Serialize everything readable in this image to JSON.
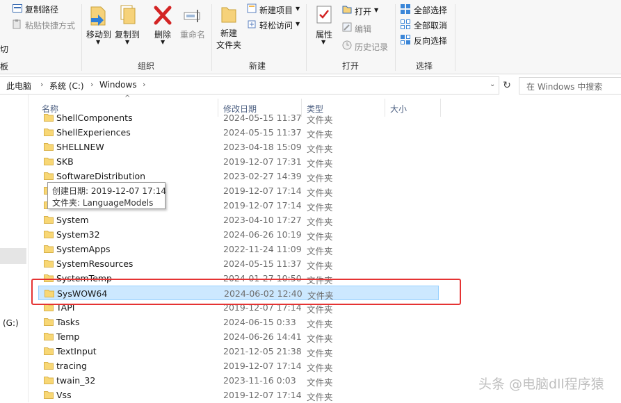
{
  "ribbon": {
    "clipboard": {
      "copy_path": "复制路径",
      "paste_shortcut": "粘贴快捷方式",
      "cut_partial": "切",
      "group_partial": "板"
    },
    "organize": {
      "move_to": "移动到",
      "copy_to": "复制到",
      "delete": "删除",
      "rename": "重命名",
      "group_label": "组织"
    },
    "new": {
      "new_folder_line1": "新建",
      "new_folder_line2": "文件夹",
      "new_item": "新建项目",
      "easy_access": "轻松访问",
      "group_label": "新建"
    },
    "open": {
      "properties": "属性",
      "open": "打开",
      "edit": "编辑",
      "history": "历史记录",
      "group_label": "打开"
    },
    "select": {
      "select_all": "全部选择",
      "select_none": "全部取消",
      "invert": "反向选择",
      "group_label": "选择"
    }
  },
  "address": {
    "crumbs": [
      "此电脑",
      "系统 (C:)",
      "Windows"
    ],
    "search_placeholder": "在 Windows 中搜索"
  },
  "nav": {
    "drive_partial": "(G:)"
  },
  "columns": {
    "name": "名称",
    "date": "修改日期",
    "type": "类型",
    "size": "大小"
  },
  "rows": [
    {
      "name": "ShellComponents",
      "date": "2024-05-15 11:37",
      "type": "文件夹"
    },
    {
      "name": "ShellExperiences",
      "date": "2024-05-15 11:37",
      "type": "文件夹"
    },
    {
      "name": "SHELLNEW",
      "date": "2023-04-18 15:09",
      "type": "文件夹"
    },
    {
      "name": "SKB",
      "date": "2019-12-07 17:31",
      "type": "文件夹"
    },
    {
      "name": "SoftwareDistribution",
      "date": "2023-02-27 14:39",
      "type": "文件夹"
    },
    {
      "name": "",
      "date": "2019-12-07 17:14",
      "type": "文件夹"
    },
    {
      "name": "",
      "date": "2019-12-07 17:14",
      "type": "文件夹"
    },
    {
      "name": "System",
      "date": "2023-04-10 17:27",
      "type": "文件夹"
    },
    {
      "name": "System32",
      "date": "2024-06-26 10:19",
      "type": "文件夹"
    },
    {
      "name": "SystemApps",
      "date": "2022-11-24 11:09",
      "type": "文件夹"
    },
    {
      "name": "SystemResources",
      "date": "2024-05-15 11:37",
      "type": "文件夹"
    },
    {
      "name": "SystemTemp",
      "date": "2024-01-27 10:50",
      "type": "文件夹"
    },
    {
      "name": "SysWOW64",
      "date": "2024-06-02 12:40",
      "type": "文件夹"
    },
    {
      "name": "TAPI",
      "date": "2019-12-07 17:14",
      "type": "文件夹"
    },
    {
      "name": "Tasks",
      "date": "2024-06-15 0:33",
      "type": "文件夹"
    },
    {
      "name": "Temp",
      "date": "2024-06-26 14:41",
      "type": "文件夹"
    },
    {
      "name": "TextInput",
      "date": "2021-12-05 21:38",
      "type": "文件夹"
    },
    {
      "name": "tracing",
      "date": "2019-12-07 17:14",
      "type": "文件夹"
    },
    {
      "name": "twain_32",
      "date": "2023-11-16 0:03",
      "type": "文件夹"
    },
    {
      "name": "Vss",
      "date": "2019-12-07 17:14",
      "type": "文件夹"
    }
  ],
  "tooltip": {
    "line1": "创建日期: 2019-12-07 17:14",
    "line2": "文件夹: LanguageModels"
  },
  "watermark": "头条 @电脑dll程序猿",
  "colors": {
    "selection_fill": "#cce8ff",
    "selection_border": "#99d1ff",
    "highlight_box": "#e53333",
    "folder_yellow": "#f8d775"
  }
}
